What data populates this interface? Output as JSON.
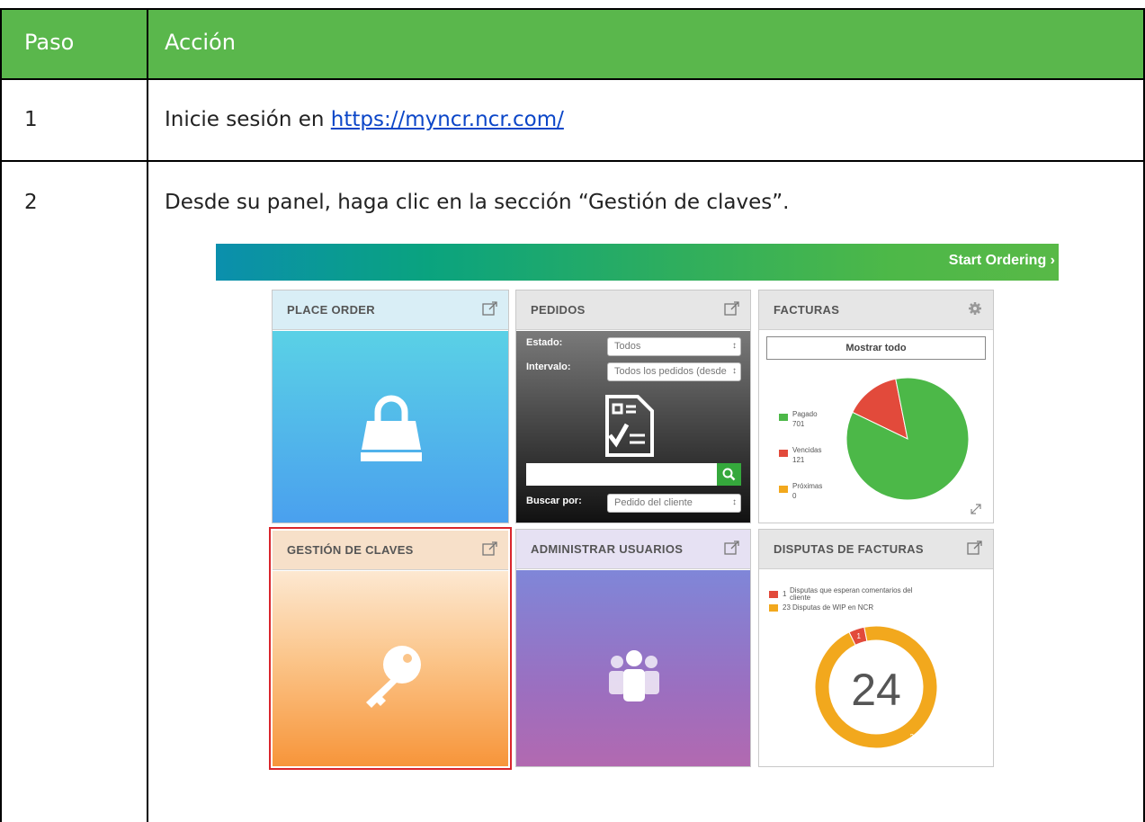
{
  "table": {
    "header": {
      "paso": "Paso",
      "accion": "Acción"
    },
    "rows": [
      {
        "step": "1",
        "text": "Inicie sesión en ",
        "link": "https://myncr.ncr.com/"
      },
      {
        "step": "2",
        "text": "Desde su panel, haga clic en la sección “Gestión de claves”."
      }
    ]
  },
  "dashboard": {
    "banner": {
      "cta": "Start Ordering ›"
    },
    "tiles": {
      "place_order": {
        "title": "PLACE ORDER"
      },
      "pedidos": {
        "title": "PEDIDOS",
        "estado_label": "Estado:",
        "estado_value": "Todos",
        "intervalo_label": "Intervalo:",
        "intervalo_value": "Todos los pedidos (desde",
        "buscar_label": "Buscar por:",
        "buscar_value": "Pedido del cliente"
      },
      "facturas": {
        "title": "FACTURAS",
        "show_all": "Mostrar todo",
        "legend": [
          {
            "label": "Pagado",
            "count": "701",
            "color": "#4cb848"
          },
          {
            "label": "Vencidas",
            "count": "121",
            "color": "#e24a3b"
          },
          {
            "label": "Próximas",
            "count": "0",
            "color": "#f2a81d"
          }
        ]
      },
      "gestion": {
        "title": "GESTIÓN DE CLAVES",
        "highlight_color": "#d9262c"
      },
      "administrar": {
        "title": "ADMINISTRAR USUARIOS"
      },
      "disputas": {
        "title": "DISPUTAS DE FACTURAS",
        "legend": [
          {
            "count": "1",
            "label": "Disputas que esperan comentarios del",
            "label2": "cliente",
            "color": "#e24a3b"
          },
          {
            "count": "23",
            "label": "Disputas de WIP en NCR",
            "color": "#f2a81d"
          }
        ],
        "total": "24",
        "red_label": "1",
        "orange_label": "23"
      }
    }
  },
  "chart_data": [
    {
      "type": "pie",
      "categories": [
        "Pagado",
        "Vencidas",
        "Próximas"
      ],
      "values": [
        701,
        121,
        0
      ],
      "colors": [
        "#4cb848",
        "#e24a3b",
        "#f2a81d"
      ],
      "legend_position": "left"
    },
    {
      "type": "pie",
      "categories": [
        "Disputas que esperan comentarios del cliente",
        "Disputas de WIP en NCR"
      ],
      "values": [
        1,
        23
      ],
      "colors": [
        "#e24a3b",
        "#f2a81d"
      ],
      "center_label": "24"
    }
  ]
}
